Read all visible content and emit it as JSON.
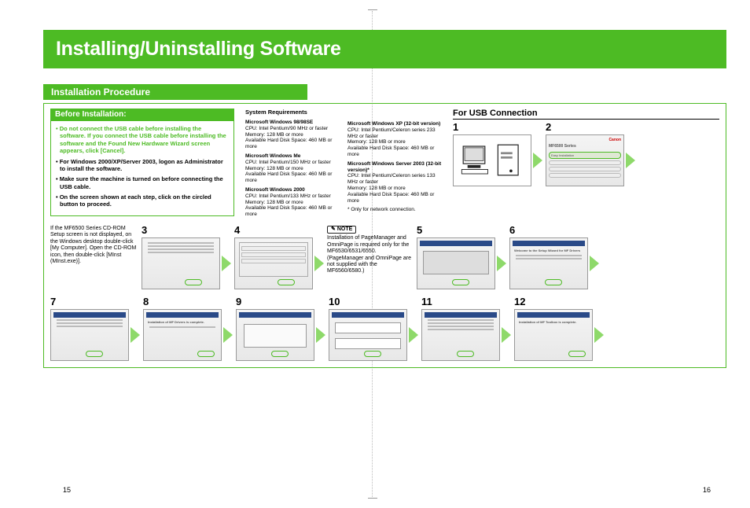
{
  "title": "Installing/Uninstalling Software",
  "section": "Installation Procedure",
  "before_heading": "Before Installation:",
  "before_bullets": {
    "b1": "Do not connect the USB cable before installing the software. If you connect the USB cable before installing the software and the Found New Hardware Wizard screen appears, click [Cancel].",
    "b2": "For Windows 2000/XP/Server 2003, logon as Administrator to install the software.",
    "b3": "Make sure the machine is turned on before connecting the USB cable.",
    "b4": "On the screen shown at each step, click on the circled button to proceed."
  },
  "sysreq_heading": "System Requirements",
  "os1": {
    "name": "Microsoft Windows 98/98SE",
    "cpu": "CPU: Intel Pentium/90 MHz or faster",
    "mem": "Memory: 128 MB or more",
    "hdd": "Available Hard Disk Space: 460 MB or more"
  },
  "os2": {
    "name": "Microsoft Windows Me",
    "cpu": "CPU: Intel Pentium/150 MHz or faster",
    "mem": "Memory: 128 MB or more",
    "hdd": "Available Hard Disk Space: 460 MB or more"
  },
  "os3": {
    "name": "Microsoft Windows 2000",
    "cpu": "CPU: Intel Pentium/133 MHz or faster",
    "mem": "Memory: 128 MB or more",
    "hdd": "Available Hard Disk Space: 460 MB or more"
  },
  "os4": {
    "name": "Microsoft Windows XP (32-bit version)",
    "cpu": "CPU: Intel Pentium/Celeron series 233 MHz or faster",
    "mem": "Memory: 128 MB or more",
    "hdd": "Available Hard Disk Space: 460 MB or more"
  },
  "os5": {
    "name": "Microsoft Windows Server 2003 (32-bit version)*",
    "cpu": "CPU: Intel Pentium/Celeron series 133 MHz or faster",
    "mem": "Memory: 128 MB or more",
    "hdd": "Available Hard Disk Space: 460 MB or more"
  },
  "footnote": "* Only for network connection.",
  "usb_heading": "For USB Connection",
  "steps": {
    "s1": "1",
    "s2": "2",
    "s3": "3",
    "s4": "4",
    "s5": "5",
    "s6": "6",
    "s7": "7",
    "s8": "8",
    "s9": "9",
    "s10": "10",
    "s11": "11",
    "s12": "12"
  },
  "row2_text": "If the MF6500 Series CD-ROM Setup screen is not displayed, on the Windows desktop double-click [My Computer]. Open the CD-ROM icon, then double-click [MInst (MInst.exe)].",
  "note_label": "NOTE",
  "note_text": "Installation of PageManager and OmniPage is required only for the MF6530/6531/6550. (PageManager and OmniPage are not supplied with the MF6560/6580.)",
  "thumb_labels": {
    "t2_title": "MF6500 Series",
    "t2_btn": "Easy Installation",
    "t6_title": "Welcome to the Setup Wizard for MF Drivers",
    "t8_title": "Installation of MF Drivers is complete.",
    "t12_title": "Installation of MF Toolbox is complete."
  },
  "page_left": "15",
  "page_right": "16"
}
